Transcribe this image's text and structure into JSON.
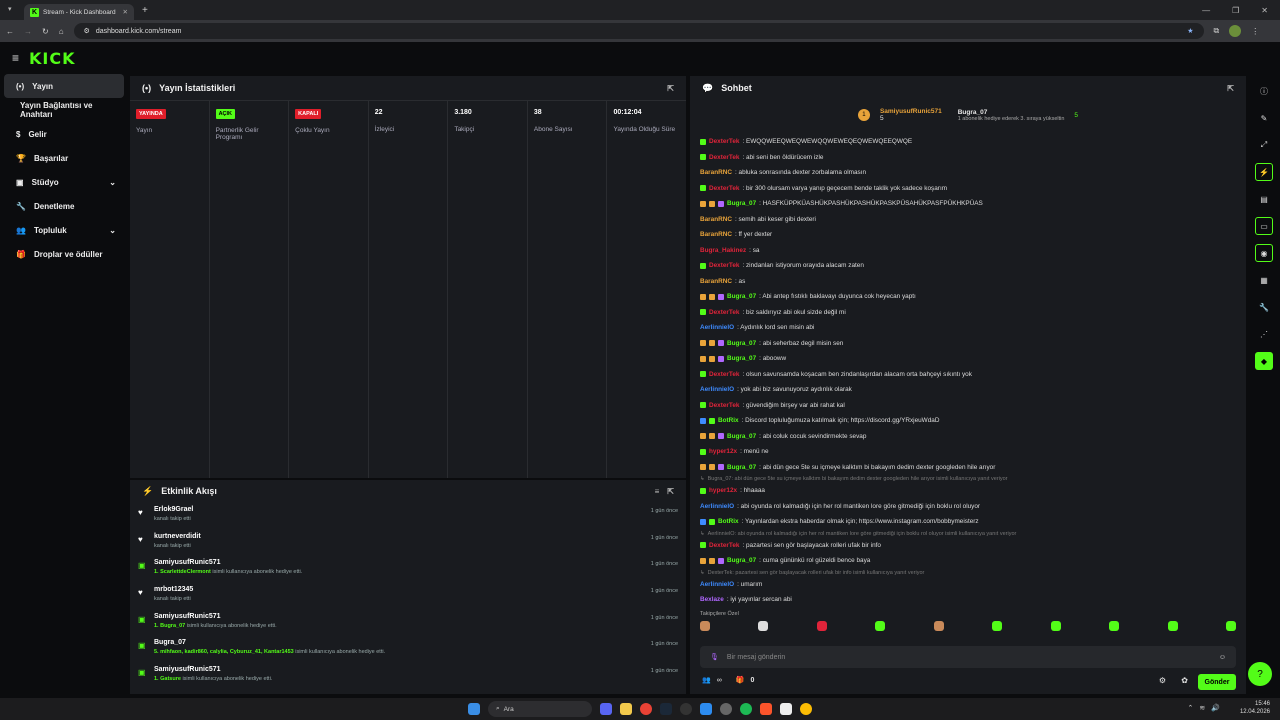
{
  "browser": {
    "tab_title": "Stream - Kick Dashboard",
    "url": "dashboard.kick.com/stream"
  },
  "logo": "KICK",
  "sidebar": {
    "items": [
      {
        "label": "Yayın",
        "icon": "stream-icon",
        "active": true
      },
      {
        "label": "Yayın Bağlantısı ve Anahtarı",
        "icon": "",
        "sub": true
      },
      {
        "label": "Gelir",
        "icon": "money-icon"
      },
      {
        "label": "Başarılar",
        "icon": "trophy-icon"
      },
      {
        "label": "Stüdyo",
        "icon": "studio-icon",
        "chev": true
      },
      {
        "label": "Denetleme",
        "icon": "wrench-icon"
      },
      {
        "label": "Topluluk",
        "icon": "community-icon",
        "chev": true
      },
      {
        "label": "Droplar ve ödüller",
        "icon": "gift-icon"
      }
    ]
  },
  "stats": {
    "title": "Yayın İstatistikleri",
    "cols": [
      {
        "badge": "YAYINDA",
        "badge_color": "red",
        "label": "Yayın"
      },
      {
        "badge": "AÇIK",
        "badge_color": "green",
        "label": "Partnerlik Gelir Programı"
      },
      {
        "badge": "KAPALI",
        "badge_color": "red",
        "label": "Çoklu Yayın"
      },
      {
        "value": "22",
        "label": "İzleyici"
      },
      {
        "value": "3.180",
        "label": "Takipçi"
      },
      {
        "value": "38",
        "label": "Abone Sayısı"
      },
      {
        "value": "00:12:04",
        "label": "Yayında Olduğu Süre"
      }
    ]
  },
  "activity": {
    "title": "Etkinlik Akışı",
    "items": [
      {
        "name": "Erlok9Grael",
        "desc": "kanalı takip etti",
        "time": "1 gün önce",
        "type": "follow"
      },
      {
        "name": "kurtneverdidit",
        "desc": "kanalı takip etti",
        "time": "1 gün önce",
        "type": "follow"
      },
      {
        "name": "SamiyusufRunic571",
        "hl": "1. ScarlettdeClermont",
        "desc": "isimli kullanıcıya abonelik hediye etti.",
        "time": "1 gün önce",
        "type": "gift"
      },
      {
        "name": "mrbot12345",
        "desc": "kanalı takip etti",
        "time": "1 gün önce",
        "type": "follow"
      },
      {
        "name": "SamiyusufRunic571",
        "hl": "1. Bugra_07",
        "desc": "isimli kullanıcıya abonelik hediye etti.",
        "time": "1 gün önce",
        "type": "gift"
      },
      {
        "name": "Bugra_07",
        "hl": "5. mihfaon, kadir860, calylia, Cyburuz_41, Kantar1453",
        "desc": "isimli kullanıcıya abonelik hediye etti.",
        "time": "1 gün önce",
        "type": "gift"
      },
      {
        "name": "SamiyusufRunic571",
        "hl": "1. Gatsure",
        "desc": "isimli kullanıcıya abonelik hediye etti.",
        "time": "1 gün önce",
        "type": "gift"
      }
    ]
  },
  "chat": {
    "title": "Sohbet",
    "top": {
      "user1": "SamiyusufRunic571",
      "count1": "5",
      "user2": "Bugra_07",
      "count2": "5",
      "note": "1 abonelik hediye ederek 3. sıraya yükseltin"
    },
    "lines": [
      {
        "u": "DexterTek",
        "c": "#e0243a",
        "b": 1,
        "t": ": EWQQWEEQWEQWEWQQWEWEQEQWEWQEEQWQE"
      },
      {
        "u": "DexterTek",
        "c": "#e0243a",
        "b": 1,
        "t": ": abi seni ben öldürücem izle"
      },
      {
        "u": "BaranRNC",
        "c": "#e8a33a",
        "t": ": abluka sonrasında dexter zorbalama olmasın"
      },
      {
        "u": "DexterTek",
        "c": "#e0243a",
        "b": 1,
        "t": ": bir 300 olursam varya yanıp geçecem bende taklik yok sadece koşarım"
      },
      {
        "u": "Bugra_07",
        "c": "#53fc18",
        "b": 3,
        "t": ": HASFKÜPPKÜASHÜKPASHÜKPASHÜKPASKPÜSAHÜKPASFPÜKHKPÜAS"
      },
      {
        "u": "BaranRNC",
        "c": "#e8a33a",
        "t": ": semih abi keser gibi dexteri"
      },
      {
        "u": "BaranRNC",
        "c": "#e8a33a",
        "t": ": ff yer dexter"
      },
      {
        "u": "Bugra_Hakinez",
        "c": "#e0243a",
        "t": ": sa"
      },
      {
        "u": "DexterTek",
        "c": "#e0243a",
        "b": 1,
        "t": ": zindanları istiyorum orayıda alacam zaten"
      },
      {
        "u": "BaranRNC",
        "c": "#e8a33a",
        "t": ": as"
      },
      {
        "u": "Bugra_07",
        "c": "#53fc18",
        "b": 3,
        "t": ": Abi antep fıstıklı baklavayı duyunca cok heyecan yaptı"
      },
      {
        "u": "DexterTek",
        "c": "#e0243a",
        "b": 1,
        "t": ": biz saldırıyız abi okul sizde değil mi"
      },
      {
        "u": "AerlinnielO",
        "c": "#3e8bff",
        "t": ": Aydınlık lord sen misin abi"
      },
      {
        "u": "Bugra_07",
        "c": "#53fc18",
        "b": 3,
        "t": ": abi seherbaz degil misin sen"
      },
      {
        "u": "Bugra_07",
        "c": "#53fc18",
        "b": 3,
        "t": ": abooww"
      },
      {
        "u": "DexterTek",
        "c": "#e0243a",
        "b": 1,
        "t": ": olsun savunsamda koşacam ben zindanlaşırdan alacam orta bahçeyi sıkıntı yok"
      },
      {
        "u": "AerlinnielO",
        "c": "#3e8bff",
        "t": ": yok abi biz savunuyoruz aydınlık olarak"
      },
      {
        "u": "DexterTek",
        "c": "#e0243a",
        "b": 1,
        "t": ": güvendiğim birşey var abi rahat kal"
      },
      {
        "u": "BotRix",
        "c": "#53fc18",
        "b": 2,
        "t": ": Discord topluluğumuza katılmak için; https://discord.gg/YRxjeuWdaD"
      },
      {
        "u": "Bugra_07",
        "c": "#53fc18",
        "b": 3,
        "t": ": abi coluk cocuk sevindirmekte sevap"
      },
      {
        "u": "hyper12x",
        "c": "#e0243a",
        "b": 1,
        "t": ": menü ne"
      },
      {
        "u": "Bugra_07",
        "c": "#53fc18",
        "b": 3,
        "t": ": abi dün gece 5te su içmeye kalktım bi bakayım dedim dexter googleden hile arıyor"
      },
      {
        "reply": "Bugra_07: abi dün gece 5te su içmeye kalktım bi bakayım dedim dexter googleden hile arıyor isimli kullanıcıya yanıt veriyor"
      },
      {
        "u": "hyper12x",
        "c": "#e0243a",
        "b": 1,
        "t": ": hhaaaa"
      },
      {
        "u": "AerlinnielO",
        "c": "#3e8bff",
        "t": ": abi oyunda rol kalmadığı için her rol mantiken lore göre gitmediği için boklu rol oluyor"
      },
      {
        "u": "BotRix",
        "c": "#53fc18",
        "b": 2,
        "t": ": Yayınlardan ekstra haberdar olmak için; https://www.instagram.com/bobbymeisterz"
      },
      {
        "reply": "AerlinnielO: abi oyunda rol kalmadığı için her rol mantiken lore göre gitmediği için boklu rol oluyor isimli kullanıcıya yanıt veriyor"
      },
      {
        "u": "DexterTek",
        "c": "#e0243a",
        "b": 1,
        "t": ": pazartesi sen gör başlayacak rolleri ufak bir info"
      },
      {
        "u": "Bugra_07",
        "c": "#53fc18",
        "b": 3,
        "t": ": cuma gününkü rol güzeldi bence baya"
      },
      {
        "reply": "DexterTek: pazartesi sen gör başlayacak rolleri ufak bir info isimli kullanıcıya yanıt veriyor"
      },
      {
        "u": "AerlinnielO",
        "c": "#3e8bff",
        "t": ": umarım"
      },
      {
        "u": "Bexlaze",
        "c": "#b067ff",
        "t": ": iyi yayınlar sercan abi"
      }
    ],
    "follower_label": "Takipçilere Özel",
    "input_placeholder": "Bir mesaj gönderin",
    "infinity": "∞",
    "count": "0",
    "send": "Gönder"
  },
  "taskbar": {
    "search": "Ara",
    "time": "15:46",
    "date": "12.04.2026"
  }
}
